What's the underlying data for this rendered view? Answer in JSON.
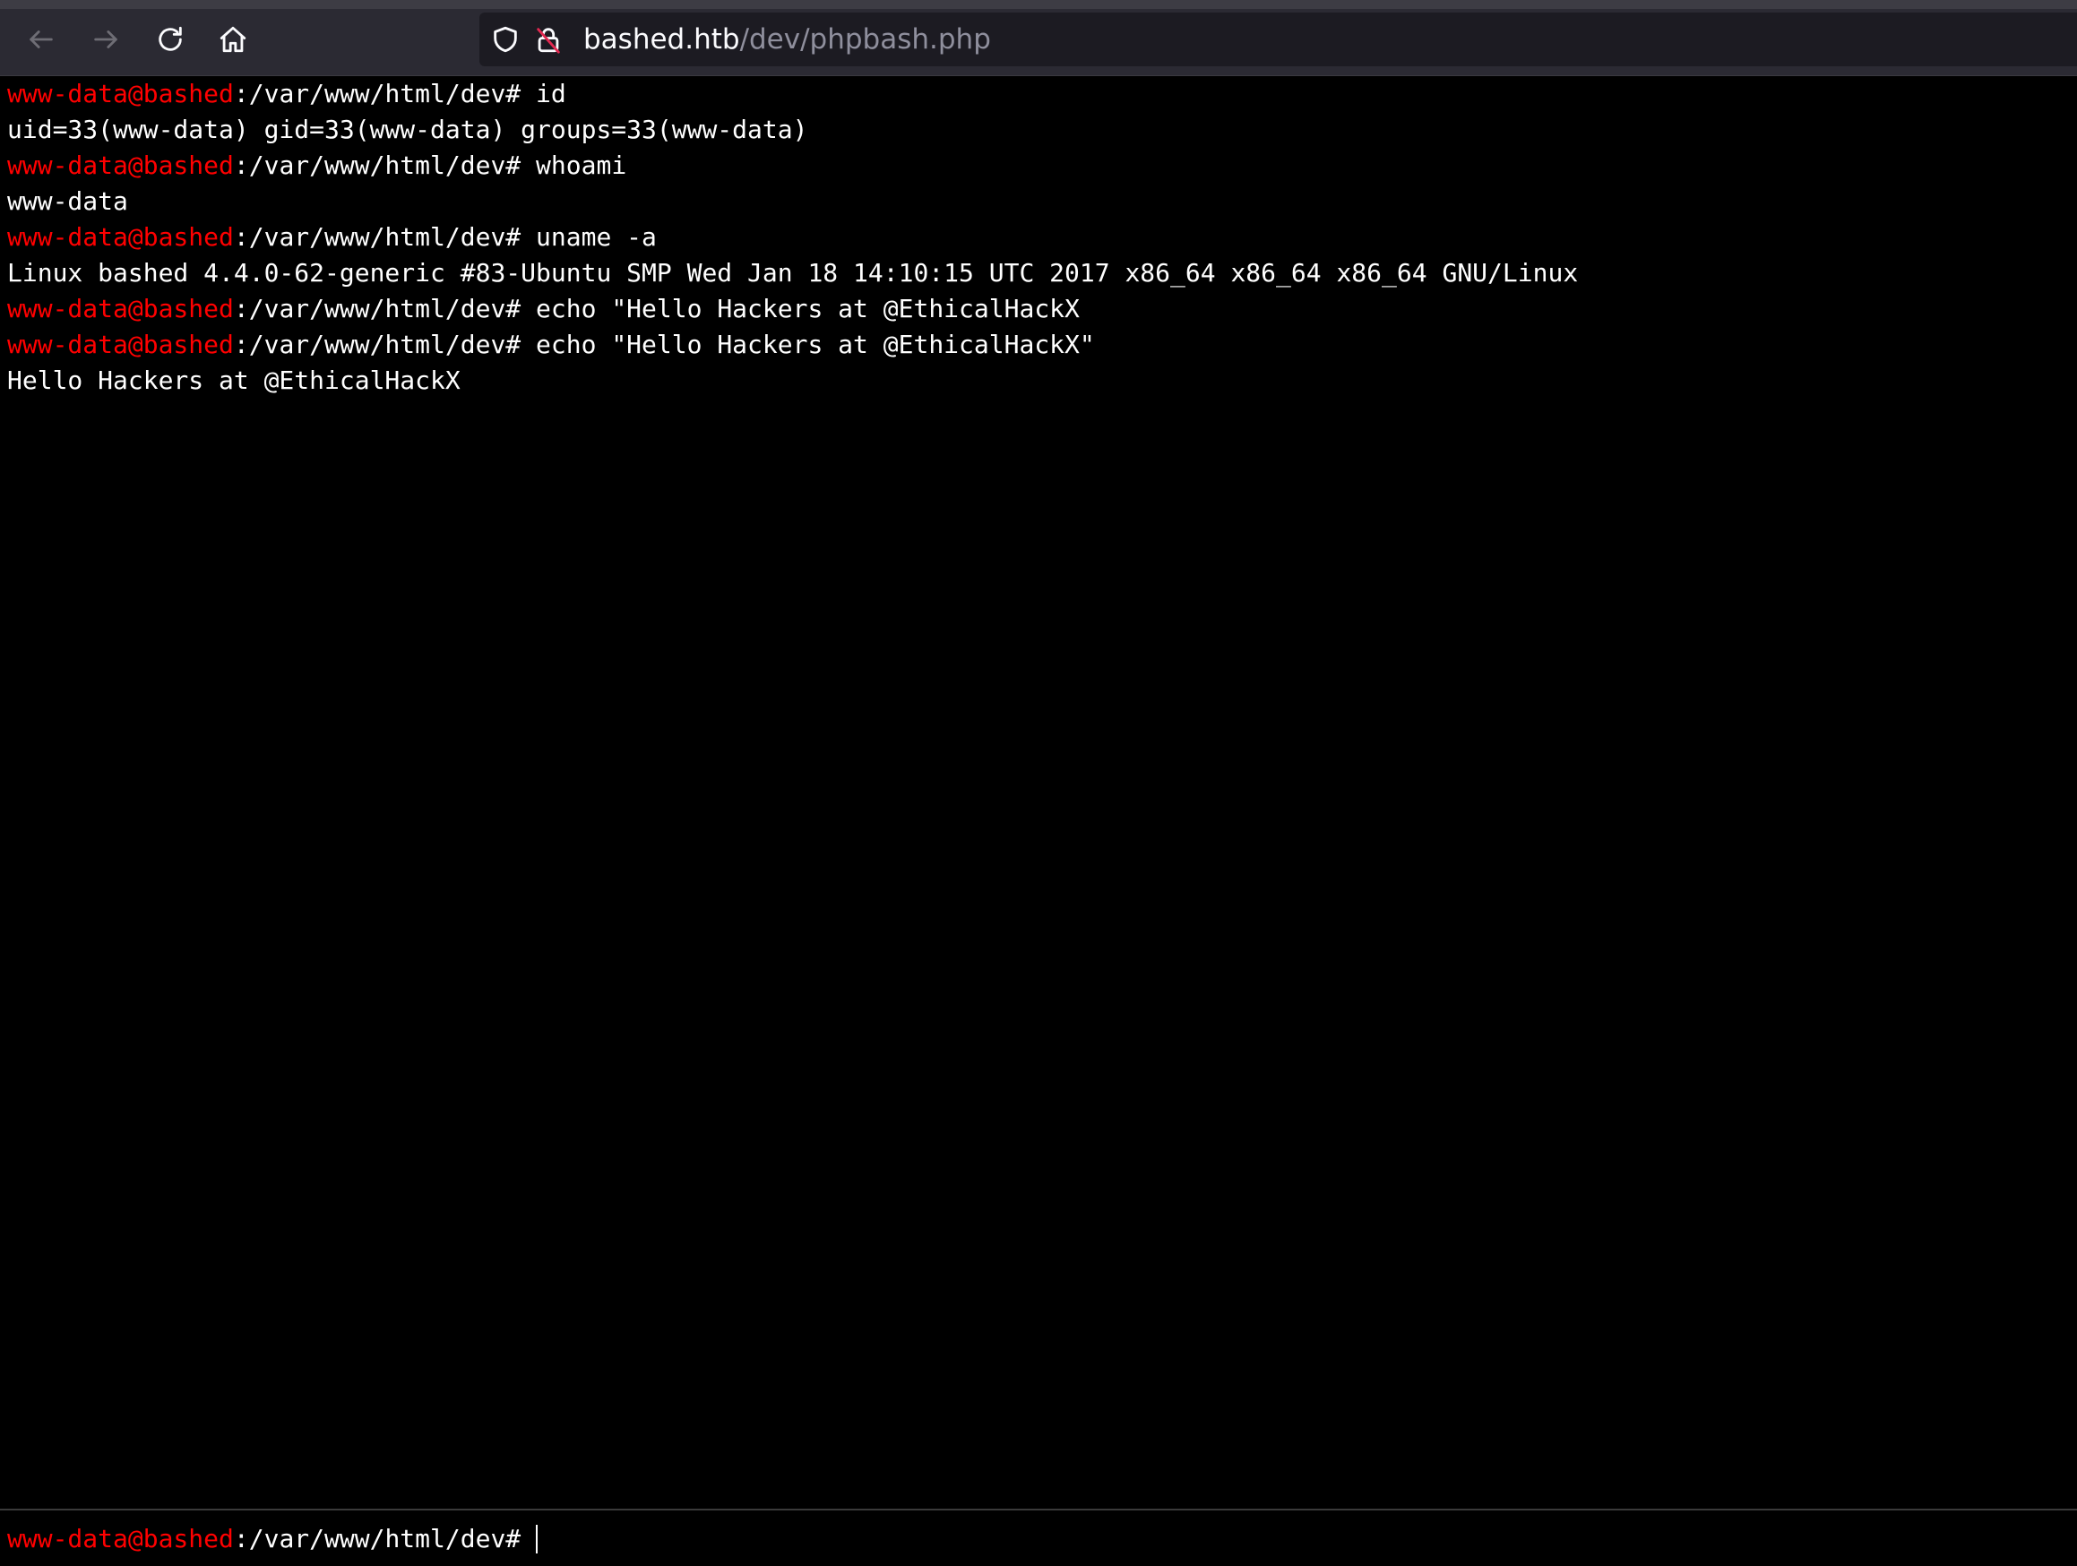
{
  "browser": {
    "url_host": "bashed.htb",
    "url_path": "/dev/phpbash.php",
    "icons": {
      "back": "back-arrow-icon",
      "forward": "forward-arrow-icon",
      "reload": "reload-icon",
      "home": "home-icon",
      "shield": "shield-icon",
      "lock": "insecure-lock-icon"
    },
    "colors": {
      "toolbar_bg": "#2b2a33",
      "url_bg": "#1c1b22"
    }
  },
  "terminal": {
    "prompt_user": "www-data@bashed",
    "prompt_path": ":/var/www/html/dev#",
    "lines": [
      {
        "type": "prompt",
        "cmd": " id"
      },
      {
        "type": "output",
        "text": "uid=33(www-data) gid=33(www-data) groups=33(www-data)"
      },
      {
        "type": "prompt",
        "cmd": " whoami"
      },
      {
        "type": "output",
        "text": "www-data"
      },
      {
        "type": "prompt",
        "cmd": " uname -a"
      },
      {
        "type": "output",
        "text": "Linux bashed 4.4.0-62-generic #83-Ubuntu SMP Wed Jan 18 14:10:15 UTC 2017 x86_64 x86_64 x86_64 GNU/Linux"
      },
      {
        "type": "prompt",
        "cmd": " echo \"Hello Hackers at @EthicalHackX"
      },
      {
        "type": "prompt",
        "cmd": " echo \"Hello Hackers at @EthicalHackX\""
      },
      {
        "type": "output",
        "text": "Hello Hackers at @EthicalHackX"
      }
    ],
    "input_value": "",
    "colors": {
      "background": "#000000",
      "prompt_user": "#ff0000",
      "text": "#ffffff"
    }
  }
}
